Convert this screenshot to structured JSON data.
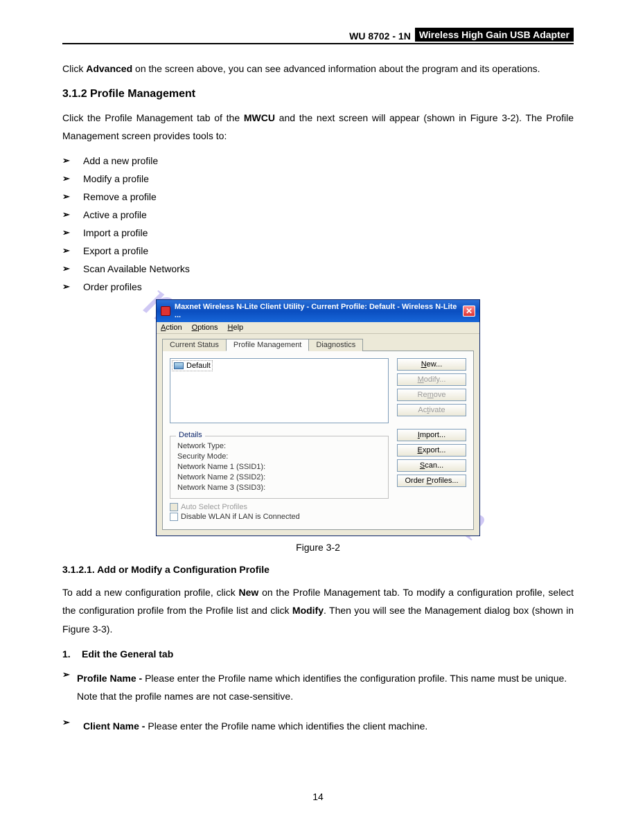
{
  "header": {
    "model": "WU 8702 - 1N",
    "product": "Wireless  High  Gain  USB  Adapter"
  },
  "intro": {
    "pre": "Click ",
    "bold": "Advanced",
    "post": " on the screen above, you can see advanced information about the program and its operations."
  },
  "section_heading": "3.1.2   Profile Management",
  "section_para": {
    "pre": "Click the Profile Management tab of the ",
    "bold": "MWCU",
    "post": " and the next screen will appear (shown in Figure 3-2). The Profile Management screen provides tools to:"
  },
  "bullets": [
    "Add a new profile",
    "Modify a profile",
    "Remove a profile",
    "Active a profile",
    "Import a profile",
    "Export a profile",
    "Scan Available Networks",
    "Order profiles"
  ],
  "dialog": {
    "title": "Maxnet Wireless N-Lite Client Utility - Current Profile: Default  - Wireless N-Lite ...",
    "menus": {
      "action": "Action",
      "options": "Options",
      "help": "Help"
    },
    "tabs": {
      "current": "Current Status",
      "profile": "Profile Management",
      "diag": "Diagnostics"
    },
    "profile_item": "Default",
    "buttons": {
      "new": "New...",
      "modify": "Modify...",
      "remove": "Remove",
      "activate": "Activate",
      "import": "Import...",
      "export": "Export...",
      "scan": "Scan...",
      "order": "Order Profiles..."
    },
    "details_legend": "Details",
    "details": {
      "network_type": "Network Type:",
      "security_mode": "Security Mode:",
      "ssid1": "Network Name 1 (SSID1):",
      "ssid2": "Network Name 2 (SSID2):",
      "ssid3": "Network Name 3 (SSID3):"
    },
    "checks": {
      "auto": "Auto Select Profiles",
      "disable_wlan": "Disable WLAN if LAN is Connected"
    }
  },
  "figure_caption": "Figure 3-2",
  "sub_heading": "3.1.2.1.   Add or Modify a Configuration Profile",
  "sub_para": {
    "p1a": "To add a new configuration profile, click ",
    "p1b": "New",
    "p1c": " on the Profile Management tab. To modify a configuration profile, select the configuration profile from the Profile list and click ",
    "p1d": "Modify",
    "p1e": ". Then you will see the Management dialog box (shown in Figure 3-3)."
  },
  "numbered": {
    "num": "1.",
    "text": "Edit the General tab"
  },
  "def_bullets": [
    {
      "bold": "Profile Name - ",
      "rest": "Please enter the Profile name which identifies the configuration profile. This name must be unique. Note that the profile names are not case-sensitive."
    },
    {
      "bold": "Client Name - ",
      "rest": "Please enter the Profile name which identifies the client machine."
    }
  ],
  "page_number": "14",
  "watermark": "manualshive.com"
}
